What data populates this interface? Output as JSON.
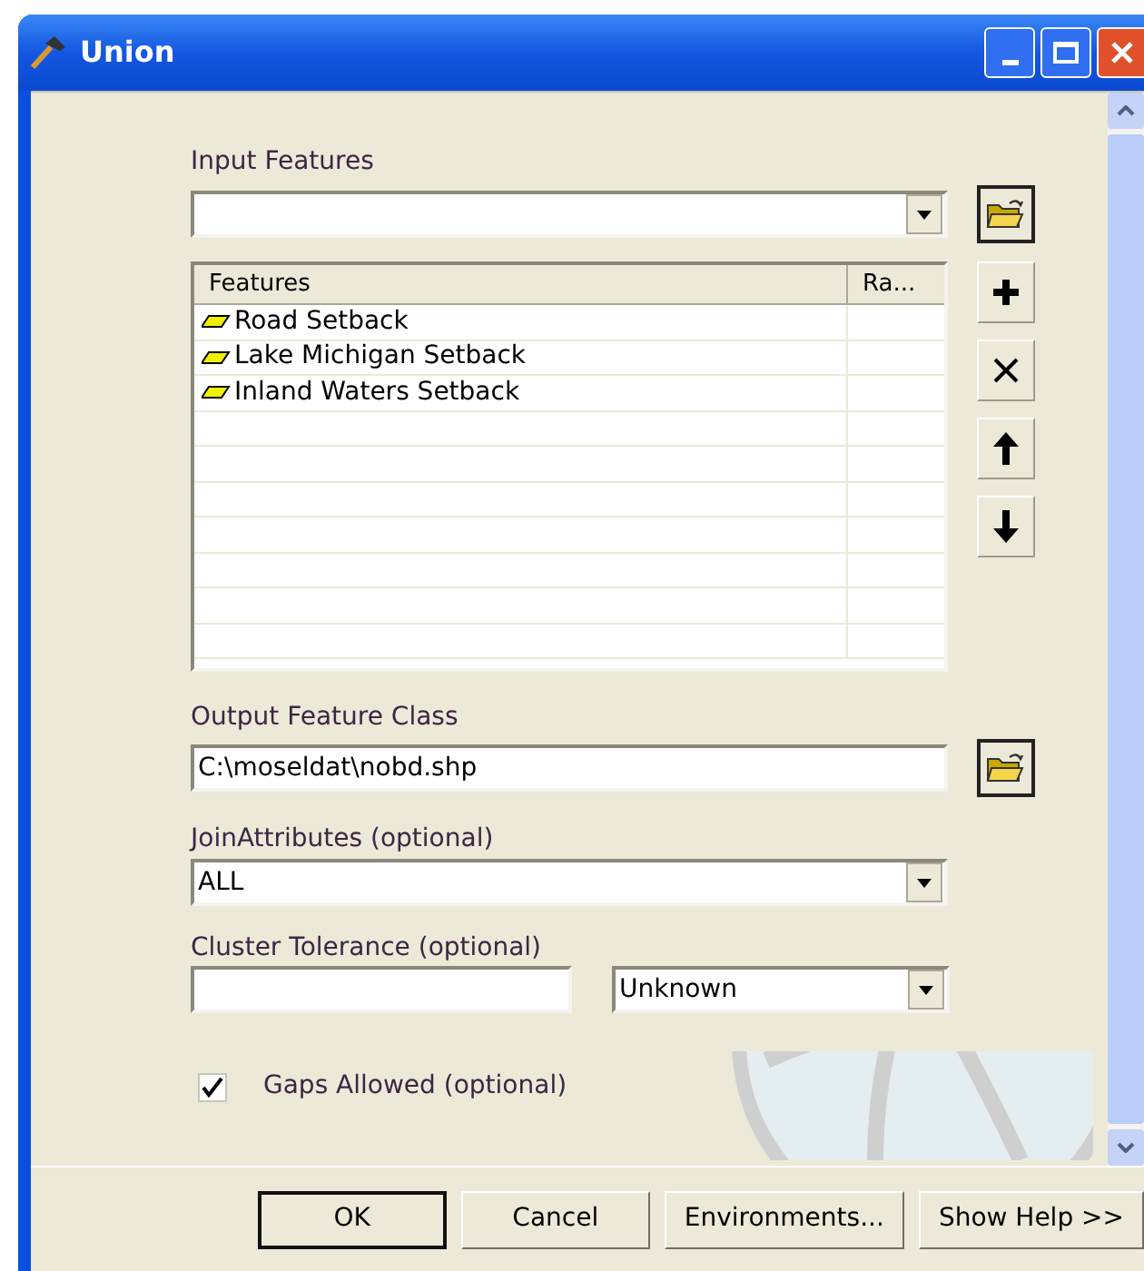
{
  "window": {
    "title": "Union"
  },
  "input_features": {
    "label": "Input Features"
  },
  "features_table": {
    "columns": [
      "Features",
      "Ra..."
    ],
    "rows": [
      {
        "name": "Road Setback"
      },
      {
        "name": "Lake Michigan Setback"
      },
      {
        "name": "Inland Waters Setback"
      }
    ]
  },
  "output_feature_class": {
    "label": "Output Feature Class",
    "value": "C:\\moseldat\\nobd.shp"
  },
  "join_attributes": {
    "label": "JoinAttributes (optional)",
    "value": "ALL"
  },
  "cluster_tolerance": {
    "label": "Cluster Tolerance (optional)",
    "unit": "Unknown"
  },
  "gaps_allowed": {
    "label": "Gaps Allowed (optional)",
    "checked": true
  },
  "buttons": [
    {
      "label": "OK",
      "default": true
    },
    {
      "label": "Cancel",
      "default": false
    },
    {
      "label": "Environments...",
      "default": false
    },
    {
      "label": "Show Help >>",
      "default": false
    }
  ]
}
